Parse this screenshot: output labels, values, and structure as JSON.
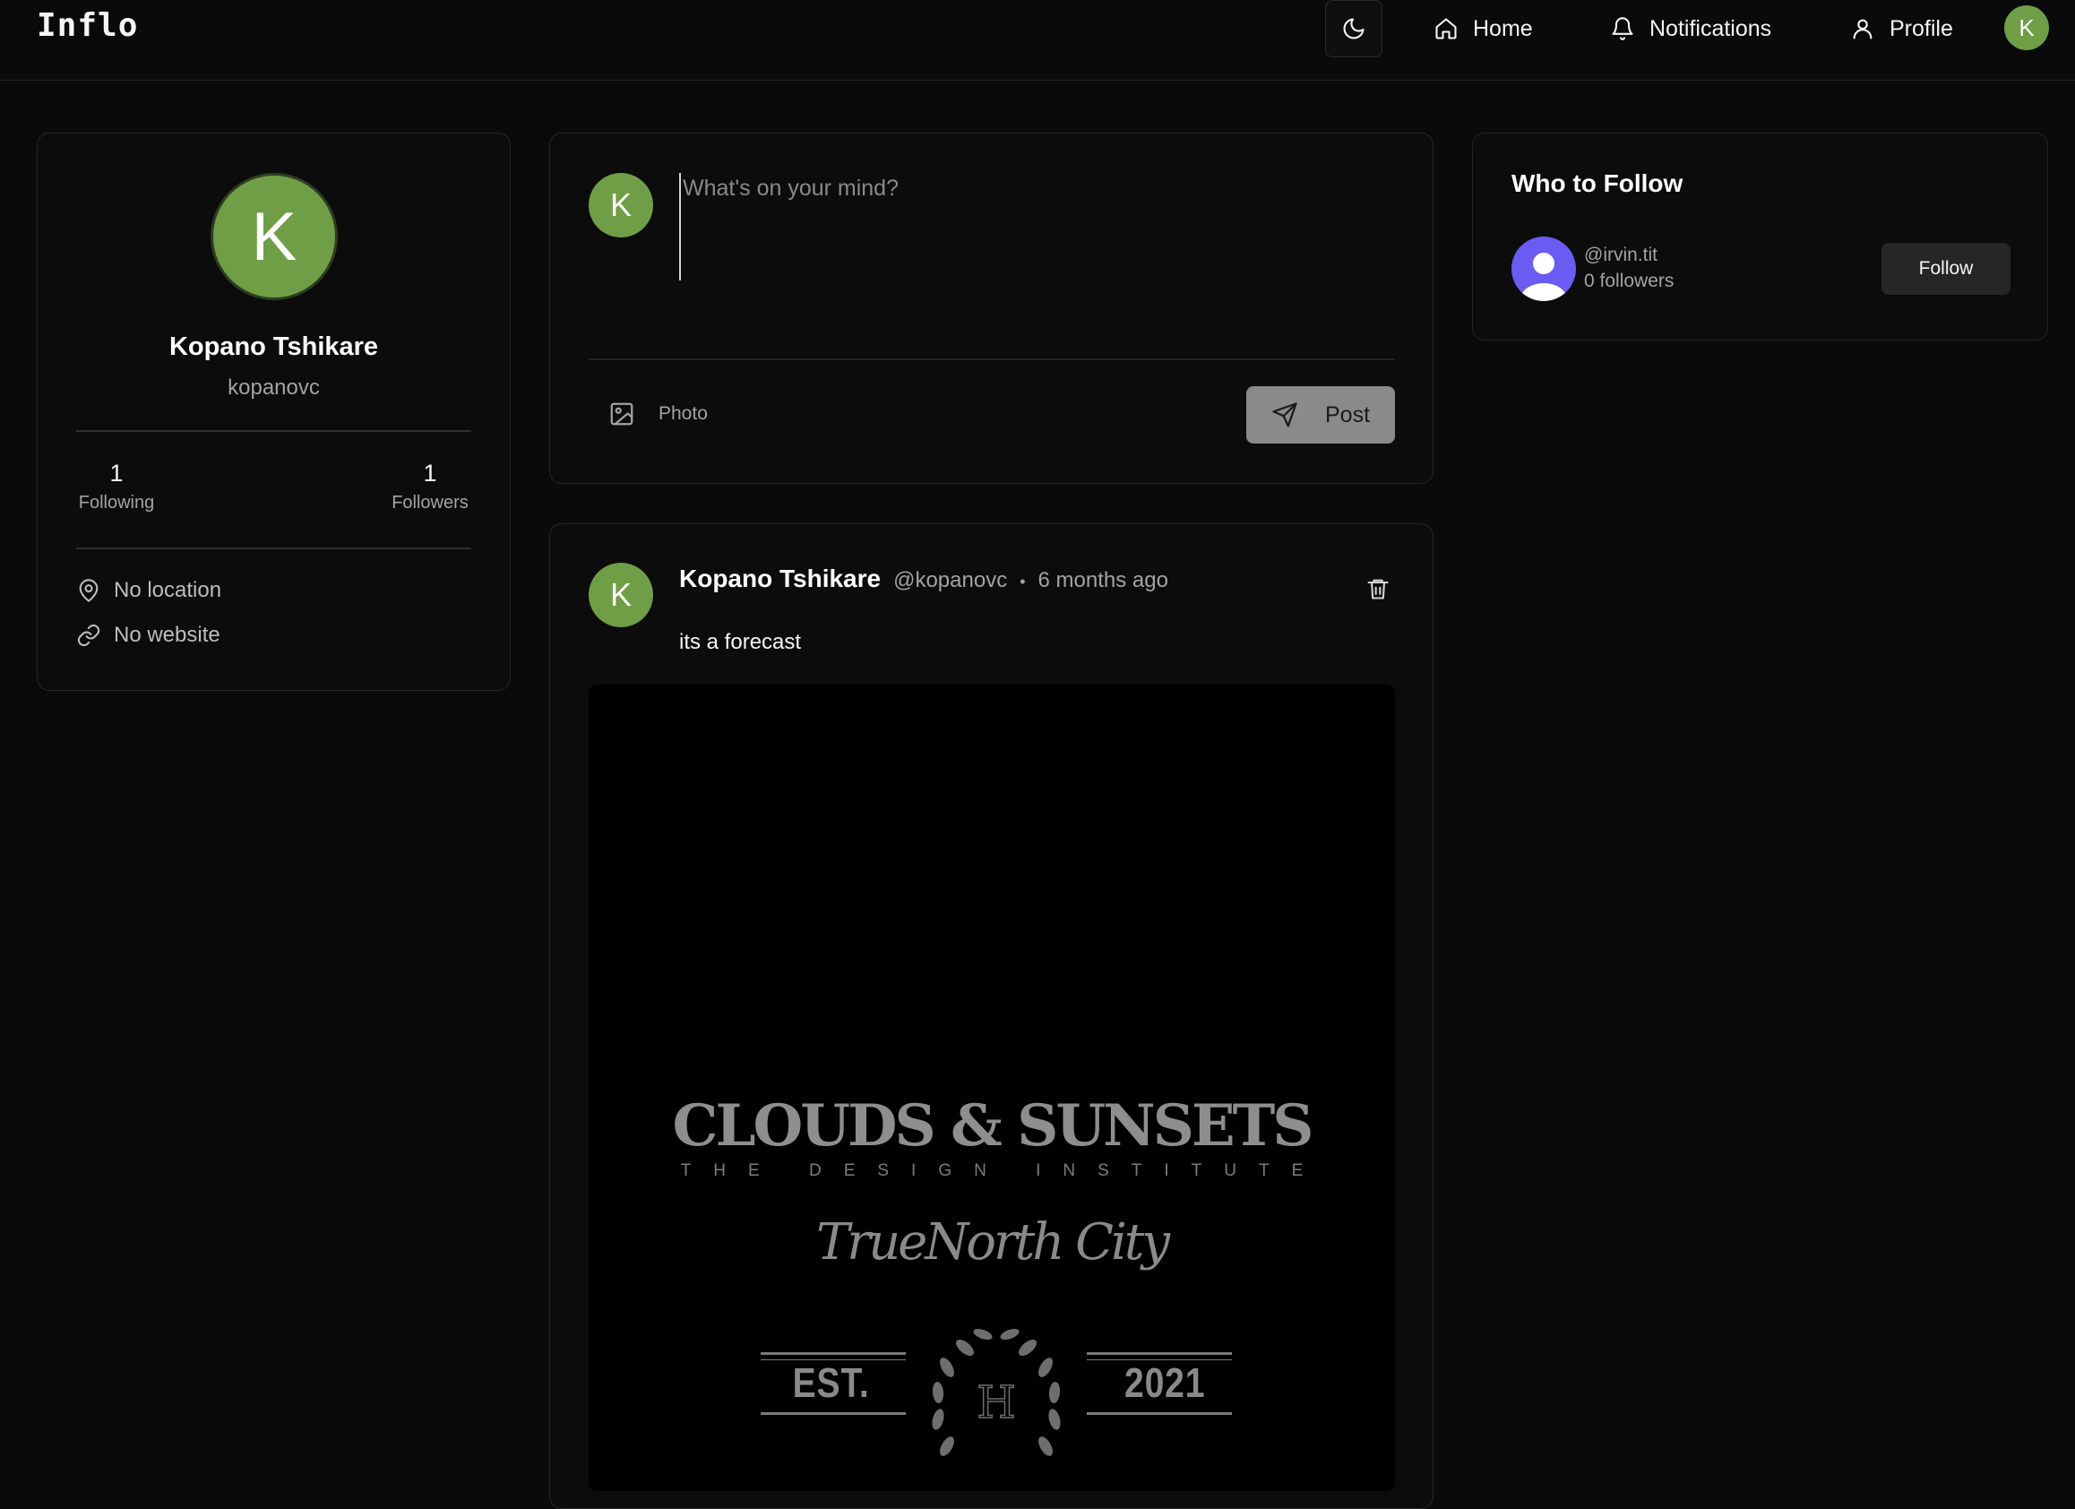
{
  "app": {
    "brand": "Inflo"
  },
  "nav": {
    "theme_icon": "moon-icon",
    "items": [
      {
        "label": "Home",
        "icon": "home-icon"
      },
      {
        "label": "Notifications",
        "icon": "bell-icon"
      },
      {
        "label": "Profile",
        "icon": "user-icon"
      }
    ],
    "avatar_initial": "K"
  },
  "profile": {
    "initial": "K",
    "name": "Kopano Tshikare",
    "username": "kopanovc",
    "following_count": "1",
    "following_label": "Following",
    "followers_count": "1",
    "followers_label": "Followers",
    "location": "No location",
    "website": "No website"
  },
  "compose": {
    "avatar_initial": "K",
    "placeholder": "What's on your mind?",
    "value": "",
    "photo_label": "Photo",
    "post_label": "Post"
  },
  "post": {
    "avatar_initial": "K",
    "author": "Kopano Tshikare",
    "handle": "@kopanovc",
    "separator": "•",
    "time": "6 months ago",
    "text": "its a forecast",
    "image_text": {
      "title": "CLOUDS & SUNSETS",
      "subtitle": "THE DESIGN INSTITUTE",
      "script": "TrueNorth City",
      "est": "EST.",
      "monogram": "H",
      "year": "2021"
    }
  },
  "who_to_follow": {
    "title": "Who to Follow",
    "users": [
      {
        "handle": "@irvin.tit",
        "followers": "0 followers",
        "button": "Follow"
      }
    ]
  },
  "colors": {
    "background": "#0a0a0a",
    "card": "#0c0c0c",
    "avatar_green": "#6f9e46",
    "avatar_purple": "#6a5bf2",
    "post_button": "#8a8a8a"
  }
}
